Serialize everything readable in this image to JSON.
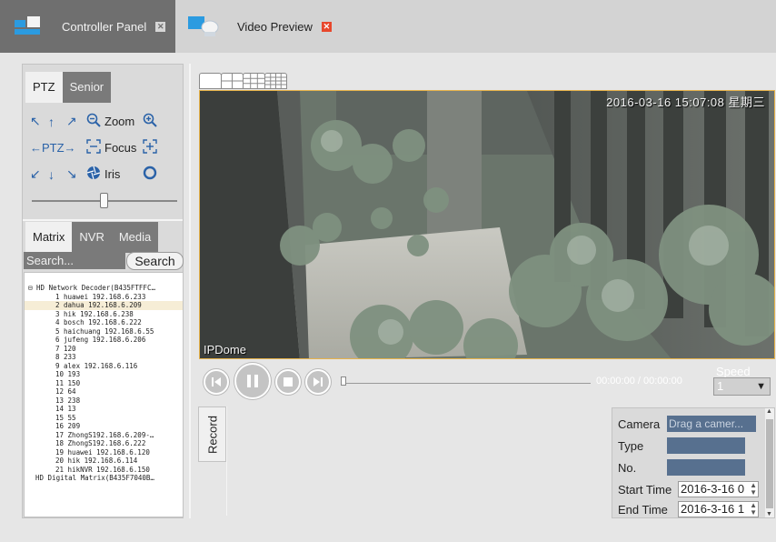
{
  "tabs": [
    {
      "label": "Controller Panel",
      "close": "✕",
      "icon": "controller-panel-icon"
    },
    {
      "label": "Video Preview",
      "close": "✕",
      "icon": "video-preview-icon"
    }
  ],
  "ptz_panel": {
    "tabs": [
      "PTZ",
      "Senior"
    ],
    "rows": [
      {
        "left": "↖",
        "mid": "↑",
        "right": "↗",
        "minus_icon": "zoom-out-icon",
        "label": "Zoom",
        "plus_icon": "zoom-in-icon"
      },
      {
        "left": "←PTZ→",
        "label": "Focus",
        "minus_icon": "focus-near-icon",
        "plus_icon": "focus-far-icon"
      },
      {
        "left": "↙",
        "mid": "↓",
        "right": "↘",
        "minus_icon": "iris-close-icon",
        "label": "Iris",
        "plus_icon": "iris-open-icon"
      }
    ],
    "ptz_speed_fraction": 0.5
  },
  "device_panel": {
    "tabs": [
      "Matrix",
      "NVR",
      "Media"
    ],
    "search_placeholder": "Search...",
    "search_button": "Search",
    "tree": {
      "root1": "⊟ HD Network Decoder(B435FTFFC…",
      "children": [
        "1 huawei 192.168.6.233",
        "2 dahua 192.168.6.209",
        "3 hik 192.168.6.238",
        "4 bosch 192.168.6.222",
        "5 haichuang 192.168.6.55",
        "6 jufeng 192.168.6.206",
        "7 120",
        "8 233",
        "9 alex 192.168.6.116",
        "10 193",
        "11 150",
        "12 64",
        "13 238",
        "14 13",
        "15 55",
        "16 209",
        "17 ZhongS192.168.6.209-…",
        "18 ZhongS192.168.6.222",
        "19 huawei 192.168.6.120",
        "20 hik 192.168.6.114",
        "21 hikNVR 192.168.6.150"
      ],
      "selected_index": 1,
      "root2": "HD Digital Matrix(B435F7040B…"
    }
  },
  "video": {
    "timestamp": "2016-03-16 15:07:08 星期三",
    "camera_name": "IPDome",
    "layout_buttons": [
      "layout-1x1-icon",
      "layout-2x2-icon",
      "layout-3x3-icon",
      "layout-4x4-icon"
    ]
  },
  "playback": {
    "time": "00:00:00 / 00:00:00",
    "speed_label": "Speed",
    "speed_value": "1",
    "progress_fraction": 0.0
  },
  "record": {
    "tab_label": "Record",
    "camera_label": "Camera",
    "camera_placeholder": "Drag a camer...",
    "type_label": "Type",
    "no_label": "No.",
    "start_label": "Start Time",
    "start_value": "2016-3-16 0",
    "end_label": "End Time",
    "end_value": "2016-3-16 1"
  },
  "colors": {
    "active_tab": "#6f6f6f",
    "close_red": "#e8472c",
    "accent_blue": "#2a62a8",
    "field_blue": "#57708f",
    "video_border": "#e6b24a"
  }
}
